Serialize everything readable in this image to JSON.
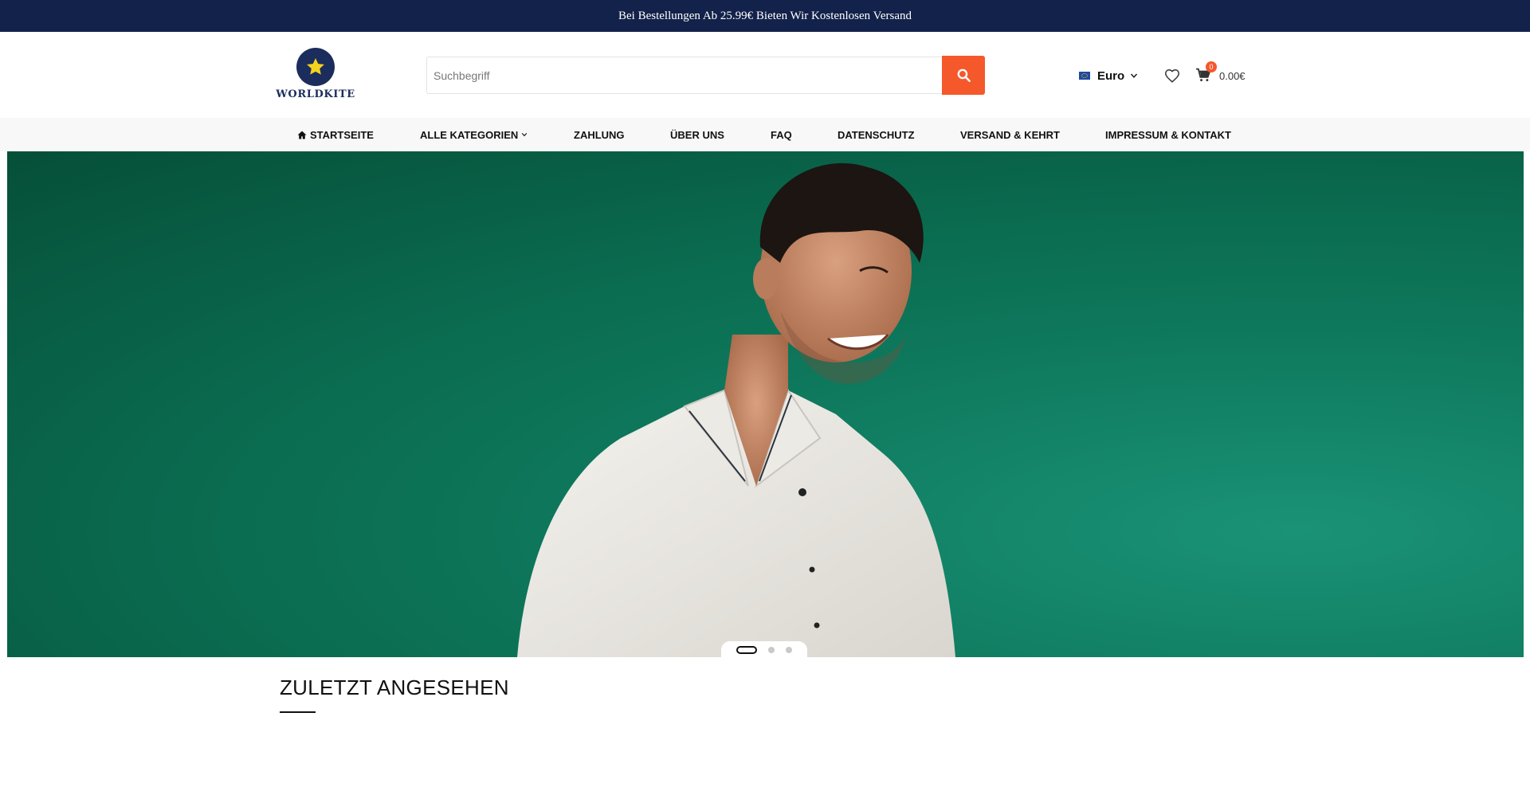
{
  "announcement": "Bei Bestellungen Ab 25.99€ Bieten Wir Kostenlosen Versand",
  "logo": {
    "text": "WORLDKITE",
    "icon": "star-icon"
  },
  "search": {
    "placeholder": "Suchbegriff",
    "value": "",
    "button_icon": "search-icon"
  },
  "currency": {
    "label": "Euro",
    "icon": "eu-flag-icon"
  },
  "wishlist": {
    "icon": "heart-icon"
  },
  "cart": {
    "count": "0",
    "total": "0.00€",
    "icon": "cart-icon"
  },
  "nav": {
    "home": "STARTSEITE",
    "categories": "ALLE KATEGORIEN",
    "payment": "ZAHLUNG",
    "about": "ÜBER UNS",
    "faq": "FAQ",
    "privacy": "DATENSCHUTZ",
    "shipping": "VERSAND & KEHRT",
    "imprint": "IMPRESSUM & KONTAKT"
  },
  "hero": {
    "slide_count": 3,
    "active_slide": 1
  },
  "recently_viewed": {
    "title": "ZULETZT ANGESEHEN"
  },
  "colors": {
    "topbar": "#13224a",
    "accent": "#f5582b",
    "hero_green": "#0a6b4f",
    "nav_bg": "#f8f8f8"
  }
}
